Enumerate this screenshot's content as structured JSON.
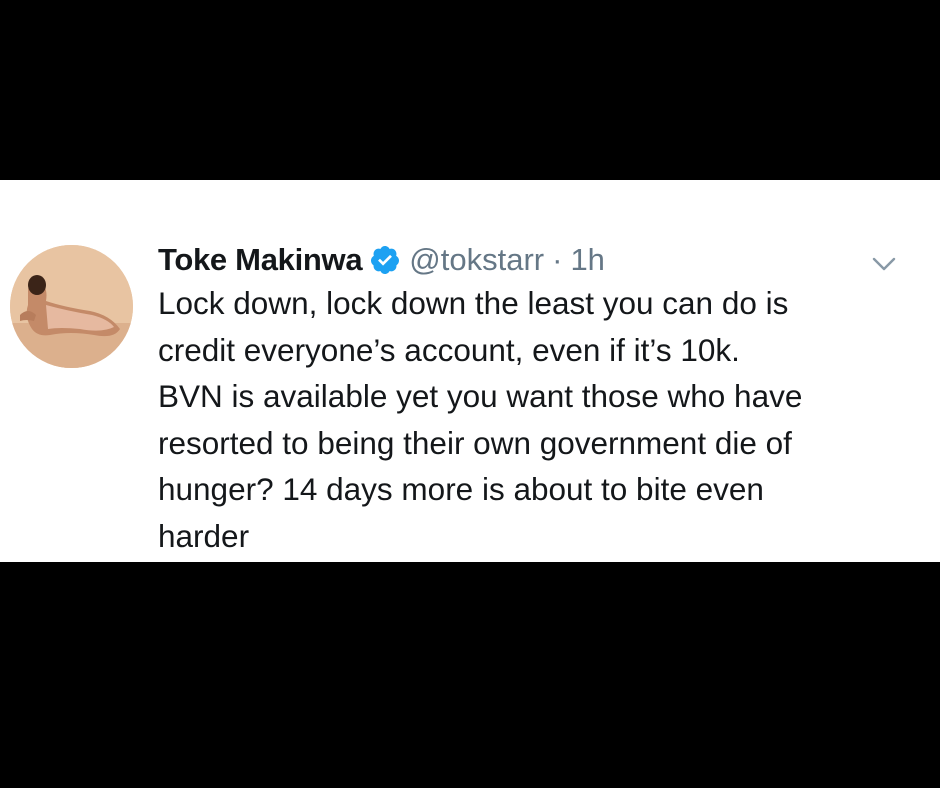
{
  "tweet": {
    "display_name": "Toke Makinwa",
    "handle": "@tokstarr",
    "separator": "·",
    "time": "1h",
    "verified_color": "#1da1f2",
    "text_lines": [
      "Lock down, lock down the least you can do is",
      "credit everyone’s account, even if it’s 10k.",
      "BVN is available yet you want those who have",
      "resorted to being their own government die of",
      "hunger? 14 days more is about to bite even",
      "harder"
    ]
  },
  "icons": {
    "verified": "verified-badge-icon",
    "menu": "chevron-down-icon"
  },
  "colors": {
    "background_bars": "#000000",
    "card": "#ffffff",
    "text_primary": "#14171a",
    "text_secondary": "#657786"
  }
}
